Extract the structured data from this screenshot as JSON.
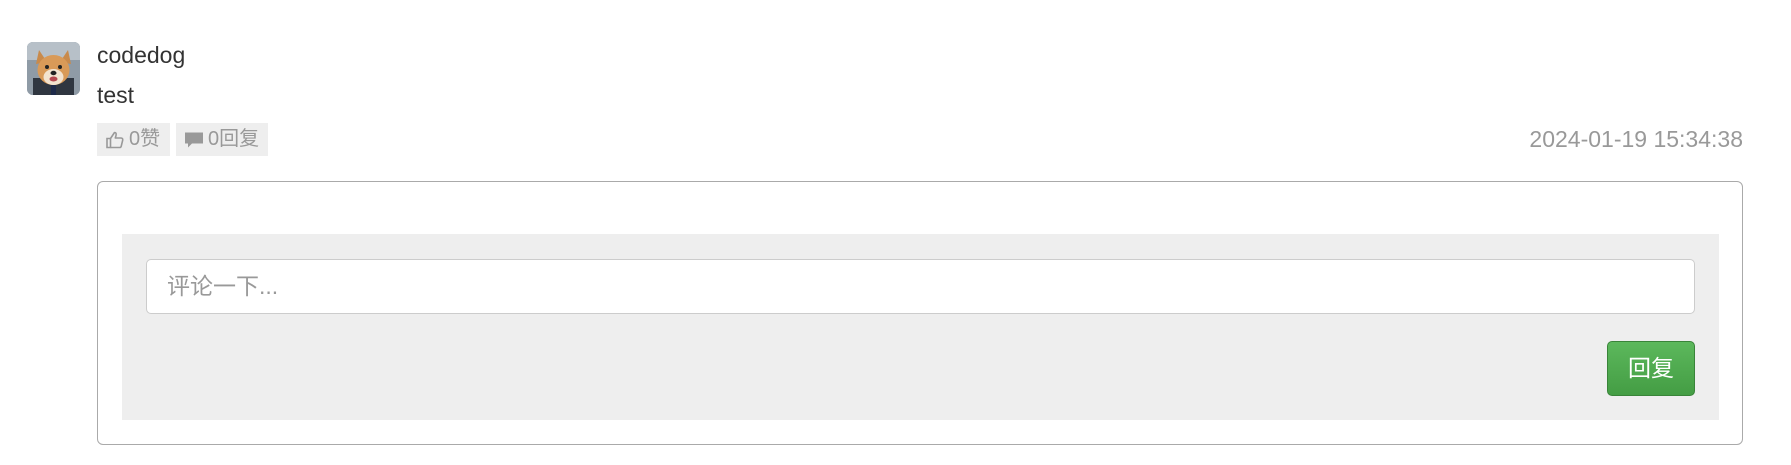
{
  "comment": {
    "avatar_icon": "dog-avatar-icon",
    "username": "codedog",
    "content": "test",
    "like_label": "0赞",
    "like_icon": "thumbs-up-icon",
    "reply_count_label": "0回复",
    "reply_count_icon": "speech-bubble-icon",
    "timestamp": "2024-01-19 15:34:38"
  },
  "reply_form": {
    "placeholder": "评论一下...",
    "value": "",
    "submit_label": "回复"
  },
  "colors": {
    "text": "#333333",
    "muted": "#999999",
    "panel": "#eeeeee",
    "button": "#5cb85c"
  }
}
